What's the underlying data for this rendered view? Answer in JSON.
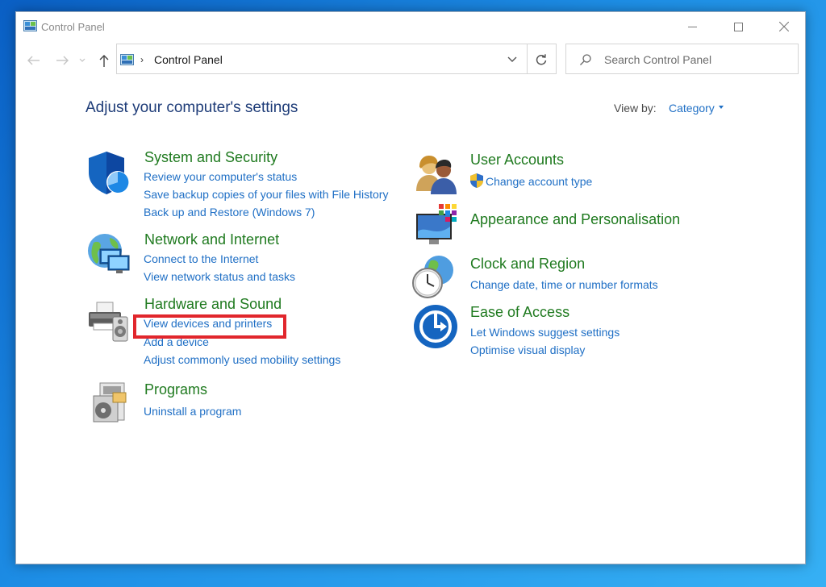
{
  "window": {
    "title": "Control Panel"
  },
  "address_bar": {
    "path": "Control Panel"
  },
  "search": {
    "placeholder": "Search Control Panel"
  },
  "page": {
    "heading": "Adjust your computer's settings",
    "view_by_label": "View by:",
    "view_by_value": "Category"
  },
  "categories": [
    {
      "title": "System and Security",
      "icon": "shield-icon",
      "links": [
        "Review your computer's status",
        "Save backup copies of your files with File History",
        "Back up and Restore (Windows 7)"
      ]
    },
    {
      "title": "Network and Internet",
      "icon": "network-globe-icon",
      "links": [
        "Connect to the Internet",
        "View network status and tasks"
      ]
    },
    {
      "title": "Hardware and Sound",
      "icon": "printer-speaker-icon",
      "links": [
        "View devices and printers",
        "Add a device",
        "Adjust commonly used mobility settings"
      ]
    },
    {
      "title": "Programs",
      "icon": "programs-icon",
      "links": [
        "Uninstall a program"
      ]
    },
    {
      "title": "User Accounts",
      "icon": "users-icon",
      "links": [
        "Change account type"
      ]
    },
    {
      "title": "Appearance and Personalisation",
      "icon": "monitor-palette-icon",
      "links": []
    },
    {
      "title": "Clock and Region",
      "icon": "clock-globe-icon",
      "links": [
        "Change date, time or number formats"
      ]
    },
    {
      "title": "Ease of Access",
      "icon": "ease-of-access-icon",
      "links": [
        "Let Windows suggest settings",
        "Optimise visual display"
      ]
    }
  ],
  "colors": {
    "title_green": "#1f7a1f",
    "link_blue": "#1f6fc5",
    "heading_blue": "#1e3c78",
    "highlight_red": "#e1262c"
  }
}
